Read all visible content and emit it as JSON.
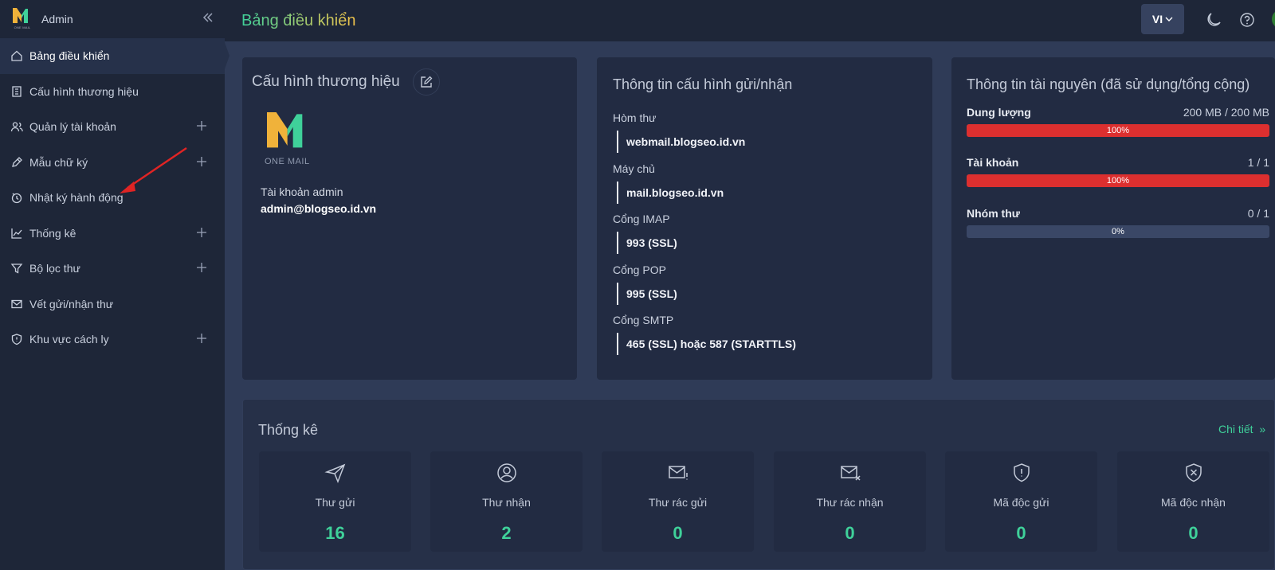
{
  "sidebar": {
    "admin_label": "Admin",
    "logo_text": "ONE MAIL",
    "items": [
      {
        "label": "Bảng điều khiển",
        "icon": "home-icon",
        "active": true,
        "expandable": false
      },
      {
        "label": "Cấu hình thương hiệu",
        "icon": "building-icon",
        "active": false,
        "expandable": false
      },
      {
        "label": "Quản lý tài khoản",
        "icon": "users-icon",
        "active": false,
        "expandable": true
      },
      {
        "label": "Mẫu chữ ký",
        "icon": "pen-icon",
        "active": false,
        "expandable": true
      },
      {
        "label": "Nhật ký hành động",
        "icon": "history-icon",
        "active": false,
        "expandable": false
      },
      {
        "label": "Thống kê",
        "icon": "chart-icon",
        "active": false,
        "expandable": true
      },
      {
        "label": "Bộ lọc thư",
        "icon": "filter-icon",
        "active": false,
        "expandable": true
      },
      {
        "label": "Vết gửi/nhận thư",
        "icon": "mail-trace-icon",
        "active": false,
        "expandable": false
      },
      {
        "label": "Khu vực cách ly",
        "icon": "shield-icon",
        "active": false,
        "expandable": true
      }
    ]
  },
  "header": {
    "title": "Bảng điều khiển",
    "language": "VI"
  },
  "brand_card": {
    "title": "Cấu hình thương hiệu",
    "logo_text": "ONE MAIL",
    "account_label": "Tài khoản admin",
    "account_value": "admin@blogseo.id.vn"
  },
  "config_card": {
    "title": "Thông tin cấu hình gửi/nhận",
    "items": [
      {
        "label": "Hòm thư",
        "value": "webmail.blogseo.id.vn"
      },
      {
        "label": "Máy chủ",
        "value": "mail.blogseo.id.vn"
      },
      {
        "label": "Cổng IMAP",
        "value": "993 (SSL)"
      },
      {
        "label": "Cổng POP",
        "value": "995 (SSL)"
      },
      {
        "label": "Cổng SMTP",
        "value": "465 (SSL) hoặc 587 (STARTTLS)"
      }
    ]
  },
  "resource_card": {
    "title": "Thông tin tài nguyên (đã sử dụng/tổng cộng)",
    "items": [
      {
        "name": "Dung lượng",
        "value": "200 MB / 200 MB",
        "percent": 100,
        "percent_label": "100%"
      },
      {
        "name": "Tài khoản",
        "value": "1 / 1",
        "percent": 100,
        "percent_label": "100%"
      },
      {
        "name": "Nhóm thư",
        "value": "0 / 1",
        "percent": 0,
        "percent_label": "0%"
      }
    ]
  },
  "stats": {
    "title": "Thống kê",
    "detail_link": "Chi tiết",
    "tiles": [
      {
        "label": "Thư gửi",
        "value": "16",
        "icon": "send-icon"
      },
      {
        "label": "Thư nhận",
        "value": "2",
        "icon": "user-circle-icon"
      },
      {
        "label": "Thư rác gửi",
        "value": "0",
        "icon": "mail-alert-icon"
      },
      {
        "label": "Thư rác nhận",
        "value": "0",
        "icon": "mail-x-icon"
      },
      {
        "label": "Mã độc gửi",
        "value": "0",
        "icon": "shield-alert-icon"
      },
      {
        "label": "Mã độc nhận",
        "value": "0",
        "icon": "shield-x-icon"
      }
    ]
  },
  "colors": {
    "accent_green": "#3fd19a",
    "accent_gold": "#f0c24a",
    "danger": "#dc2f2f",
    "annotation_arrow": "#e02424"
  }
}
